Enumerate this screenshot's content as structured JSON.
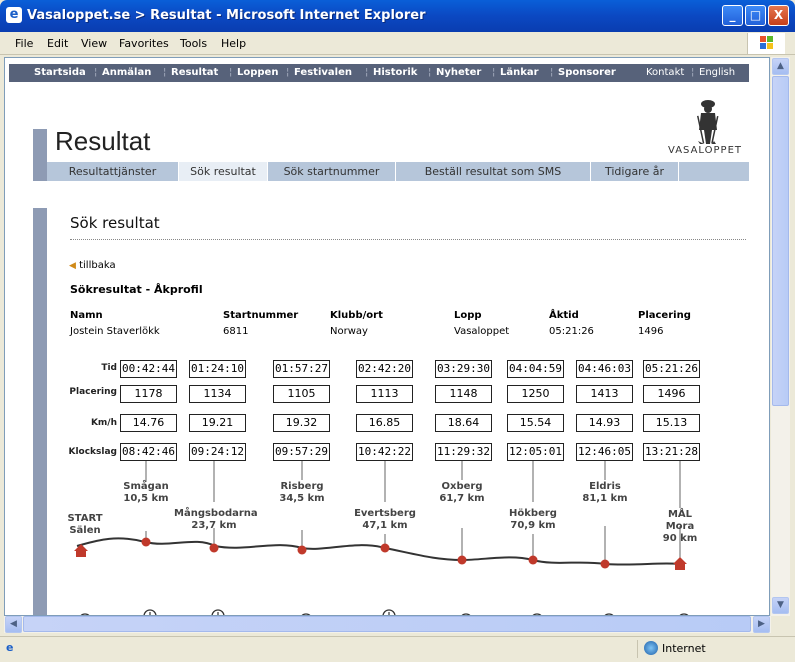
{
  "window": {
    "title": "Vasaloppet.se > Resultat - Microsoft Internet Explorer",
    "minimize": "_",
    "maximize": "□",
    "close": "X"
  },
  "menu": [
    "File",
    "Edit",
    "View",
    "Favorites",
    "Tools",
    "Help"
  ],
  "site_nav": {
    "items": [
      "Startsida",
      "Anmälan",
      "Resultat",
      "Loppen",
      "Festivalen",
      "Historik",
      "Nyheter",
      "Länkar",
      "Sponsorer"
    ],
    "right": [
      "Kontakt",
      "English"
    ]
  },
  "page_title": "Resultat",
  "logo_text": "VASALOPPET",
  "tabs": [
    "Resultattjänster",
    "Sök resultat",
    "Sök startnummer",
    "Beställ resultat som SMS",
    "Tidigare år"
  ],
  "section_title": "Sök resultat",
  "back_link": "tillbaka",
  "subheading": "Sökresultat - Åkprofil",
  "runner": {
    "headers": [
      "Namn",
      "Startnummer",
      "Klubb/ort",
      "Lopp",
      "Åktid",
      "Placering"
    ],
    "values": [
      "Jostein Staverlökk",
      "6811",
      "Norway",
      "Vasaloppet",
      "05:21:26",
      "1496"
    ]
  },
  "row_labels": {
    "tid": "Tid",
    "placering": "Placering",
    "kmh": "Km/h",
    "klockslag": "Klockslag"
  },
  "splits": {
    "tid": [
      "00:42:44",
      "01:24:10",
      "01:57:27",
      "02:42:20",
      "03:29:30",
      "04:04:59",
      "04:46:03",
      "05:21:26"
    ],
    "placering": [
      "1178",
      "1134",
      "1105",
      "1113",
      "1148",
      "1250",
      "1413",
      "1496"
    ],
    "kmh": [
      "14.76",
      "19.21",
      "19.32",
      "16.85",
      "18.64",
      "15.54",
      "14.93",
      "15.13"
    ],
    "klockslag": [
      "08:42:46",
      "09:24:12",
      "09:57:29",
      "10:42:22",
      "11:29:32",
      "12:05:01",
      "12:46:05",
      "13:21:28"
    ]
  },
  "checkpoints": [
    {
      "name": "START",
      "sub": "Sälen"
    },
    {
      "name": "Smågan",
      "sub": "10,5 km"
    },
    {
      "name": "Mångsbodarna",
      "sub": "23,7 km"
    },
    {
      "name": "Risberg",
      "sub": "34,5 km"
    },
    {
      "name": "Evertsberg",
      "sub": "47,1 km"
    },
    {
      "name": "Oxberg",
      "sub": "61,7 km"
    },
    {
      "name": "Hökberg",
      "sub": "70,9 km"
    },
    {
      "name": "Eldris",
      "sub": "81,1 km"
    },
    {
      "name": "MÅL",
      "sub": "Mora",
      "sub2": "90 km"
    }
  ],
  "status": {
    "zone": "Internet"
  },
  "colors": {
    "nav": "#57627a",
    "tabs": "#b6c6da",
    "accent": "#8e9bb4",
    "marker": "#c0392b",
    "titlebar": "#0b48c2"
  }
}
